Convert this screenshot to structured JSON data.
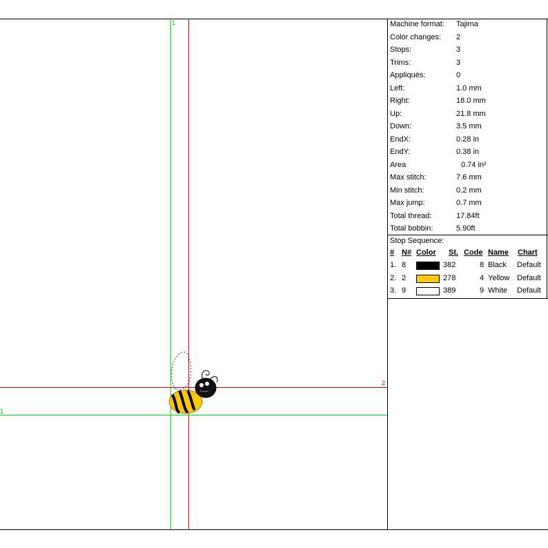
{
  "canvas": {
    "axis_labels": {
      "green_vertical": "1",
      "green_horizontal": "1",
      "red_horizontal": "2"
    }
  },
  "stats": [
    {
      "label": "Machine format:",
      "value": "Tajima"
    },
    {
      "label": "Color changes:",
      "value": "2"
    },
    {
      "label": "Stops:",
      "value": "3"
    },
    {
      "label": "Trims:",
      "value": "3"
    },
    {
      "label": "Appliqués:",
      "value": "0"
    },
    {
      "label": "Left:",
      "value": "1.0 mm"
    },
    {
      "label": "Right:",
      "value": "18.0 mm"
    },
    {
      "label": "Up:",
      "value": "21.8 mm"
    },
    {
      "label": "Down:",
      "value": "3.5 mm"
    },
    {
      "label": "EndX:",
      "value": "0.28 in"
    },
    {
      "label": "EndY:",
      "value": "0.38 in"
    },
    {
      "label": "Area",
      "value": "0.74 in²"
    },
    {
      "label": "Max stitch:",
      "value": "7.6 mm"
    },
    {
      "label": "Min stitch:",
      "value": "0.2 mm"
    },
    {
      "label": "Max jump:",
      "value": "0.7 mm"
    },
    {
      "label": "Total thread:",
      "value": "17.84ft"
    },
    {
      "label": "Total bobbin:",
      "value": "5.90ft"
    }
  ],
  "stop_sequence": {
    "title": "Stop Sequence:",
    "headers": {
      "num": "#",
      "n_num": "N#",
      "color": "Color",
      "st": "St.",
      "code": "Code",
      "name": "Name",
      "chart": "Chart"
    },
    "rows": [
      {
        "num": "1.",
        "n_num": "8",
        "color": "#000000",
        "st": "382",
        "code": "8",
        "name": "Black",
        "chart": "Default"
      },
      {
        "num": "2.",
        "n_num": "2",
        "color": "#ffc800",
        "st": "278",
        "code": "4",
        "name": "Yellow",
        "chart": "Default"
      },
      {
        "num": "3.",
        "n_num": "9",
        "color": "#ffffff",
        "st": "389",
        "code": "9",
        "name": "White",
        "chart": "Default"
      }
    ]
  },
  "colors": {
    "green_guide": "#00e000",
    "red_guide": "#e00000"
  }
}
